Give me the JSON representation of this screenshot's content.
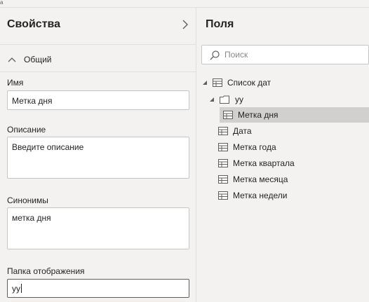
{
  "top_marker": "а",
  "properties": {
    "title": "Свойства",
    "section": "Общий",
    "name_label": "Имя",
    "name_value": "Метка дня",
    "description_label": "Описание",
    "description_placeholder": "Введите описание",
    "synonyms_label": "Синонимы",
    "synonyms_value": "метка дня",
    "folder_label": "Папка отображения",
    "folder_value": "уу"
  },
  "fields": {
    "title": "Поля",
    "search_placeholder": "Поиск",
    "table_name": "Список дат",
    "folder_name": "уу",
    "folder_items": [
      "Метка дня"
    ],
    "items": [
      "Дата",
      "Метка года",
      "Метка квартала",
      "Метка месяца",
      "Метка недели"
    ]
  },
  "colors": {
    "background": "#f3f2f1",
    "selected": "#d2d0ce",
    "border": "#c8c6c4",
    "icon": "#605e5c"
  },
  "icons": {
    "collapse_pane": "chevron-right-icon",
    "section_toggle": "chevron-up-icon",
    "search": "search-icon",
    "table": "table-icon",
    "folder": "folder-icon",
    "field": "table-field-icon"
  }
}
